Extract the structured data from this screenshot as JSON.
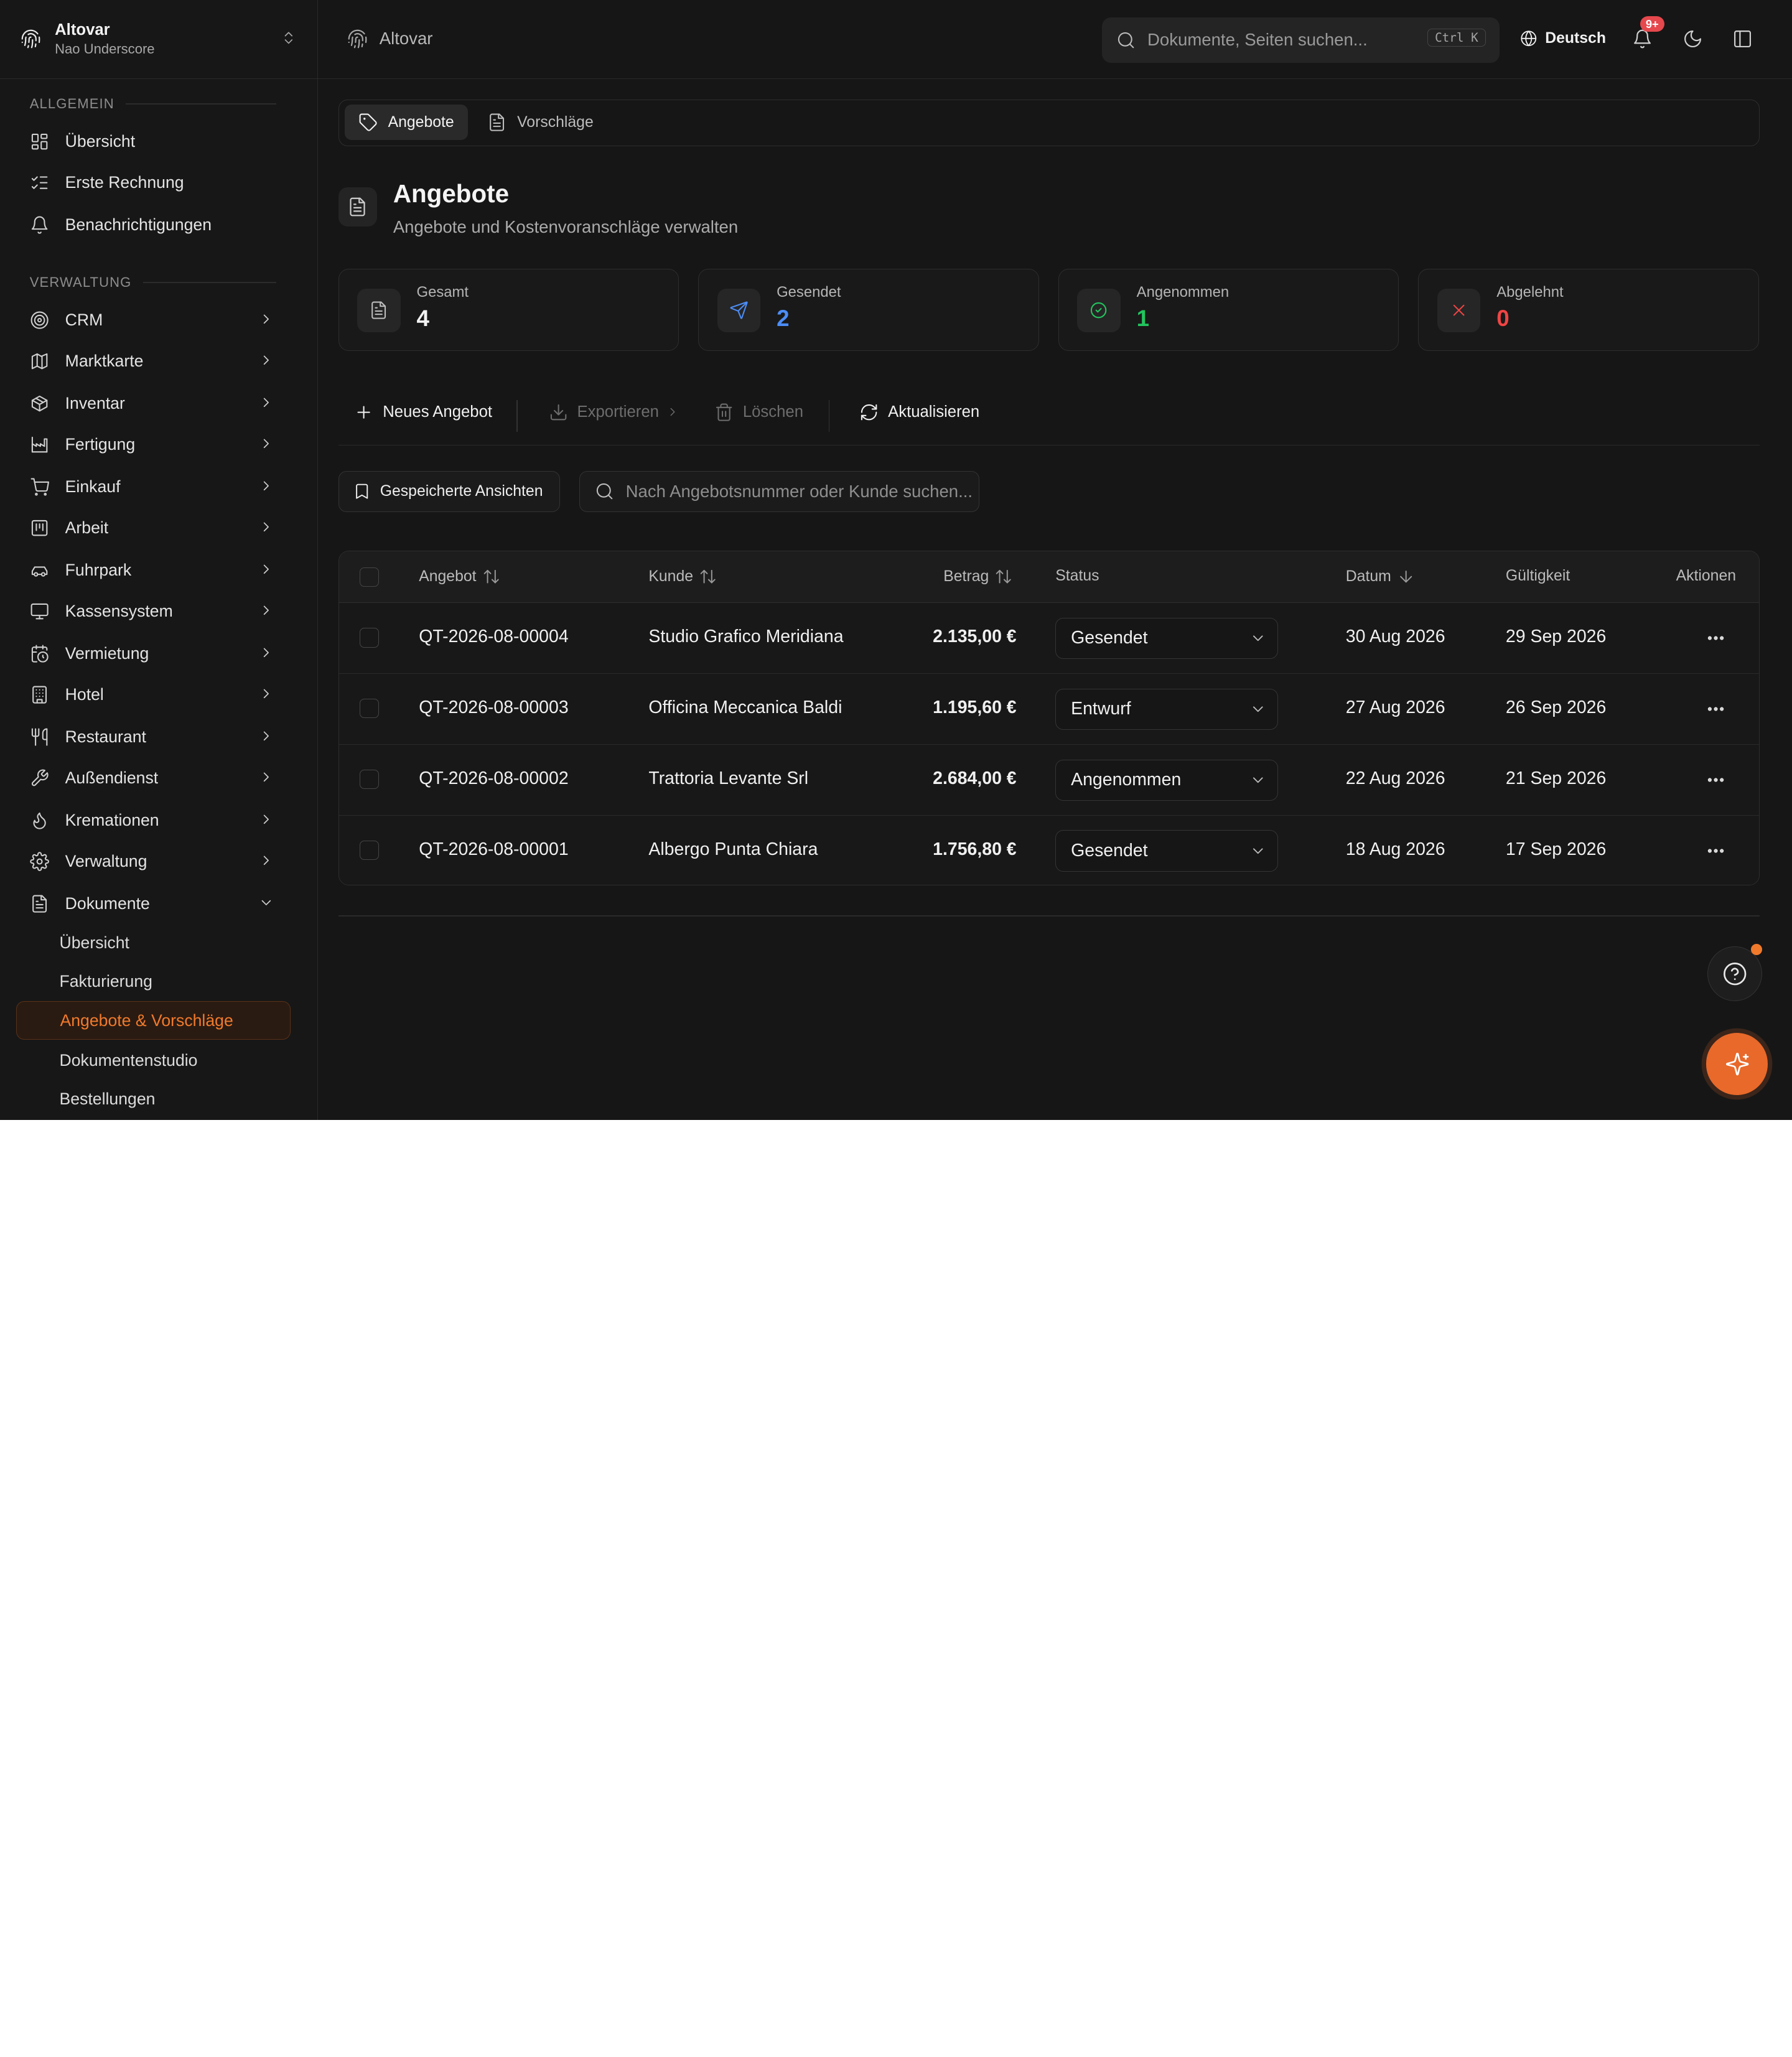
{
  "sidebar": {
    "org_name": "Altovar",
    "org_sub": "Nao Underscore",
    "section_general": "ALLGEMEIN",
    "section_admin": "VERWALTUNG",
    "general_items": [
      {
        "label": "Übersicht",
        "icon": "dashboard-icon"
      },
      {
        "label": "Erste Rechnung",
        "icon": "checklist-icon"
      },
      {
        "label": "Benachrichtigungen",
        "icon": "bell-icon"
      }
    ],
    "admin_items": [
      {
        "label": "CRM",
        "icon": "target-icon"
      },
      {
        "label": "Marktkarte",
        "icon": "map-icon"
      },
      {
        "label": "Inventar",
        "icon": "package-icon"
      },
      {
        "label": "Fertigung",
        "icon": "factory-icon"
      },
      {
        "label": "Einkauf",
        "icon": "cart-icon"
      },
      {
        "label": "Arbeit",
        "icon": "calendar-grid-icon"
      },
      {
        "label": "Fuhrpark",
        "icon": "car-icon"
      },
      {
        "label": "Kassensystem",
        "icon": "monitor-icon"
      },
      {
        "label": "Vermietung",
        "icon": "calendar-clock-icon"
      },
      {
        "label": "Hotel",
        "icon": "building-icon"
      },
      {
        "label": "Restaurant",
        "icon": "utensils-icon"
      },
      {
        "label": "Außendienst",
        "icon": "wrench-icon"
      },
      {
        "label": "Kremationen",
        "icon": "flame-icon"
      },
      {
        "label": "Verwaltung",
        "icon": "gear-icon"
      },
      {
        "label": "Dokumente",
        "icon": "document-icon"
      }
    ],
    "doc_subitems": [
      "Übersicht",
      "Fakturierung",
      "Angebote & Vorschläge",
      "Dokumentenstudio",
      "Bestellungen"
    ]
  },
  "topbar": {
    "breadcrumb": "Altovar",
    "search_placeholder": "Dokumente, Seiten suchen...",
    "search_shortcut": "Ctrl K",
    "language": "Deutsch",
    "notification_badge": "9+"
  },
  "tabs": [
    {
      "label": "Angebote",
      "active": true
    },
    {
      "label": "Vorschläge",
      "active": false
    }
  ],
  "page": {
    "title": "Angebote",
    "subtitle": "Angebote und Kostenvoranschläge verwalten"
  },
  "stats": [
    {
      "label": "Gesamt",
      "value": "4",
      "color": "#f2f2f2",
      "icon": "document-icon"
    },
    {
      "label": "Gesendet",
      "value": "2",
      "color": "#4c8df6",
      "icon": "send-icon"
    },
    {
      "label": "Angenommen",
      "value": "1",
      "color": "#22c55e",
      "icon": "check-circle-icon"
    },
    {
      "label": "Abgelehnt",
      "value": "0",
      "color": "#ef4444",
      "icon": "x-icon"
    }
  ],
  "toolbar": {
    "new": "Neues Angebot",
    "export": "Exportieren",
    "delete": "Löschen",
    "refresh": "Aktualisieren"
  },
  "filters": {
    "saved_views": "Gespeicherte Ansichten",
    "search_placeholder": "Nach Angebotsnummer oder Kunde suchen..."
  },
  "table": {
    "headers": [
      "Angebot",
      "Kunde",
      "Betrag",
      "Status",
      "Datum",
      "Gültigkeit",
      "Aktionen"
    ],
    "rows": [
      {
        "id": "QT-2026-08-00004",
        "customer": "Studio Grafico Meridiana",
        "amount": "2.135,00 €",
        "status": "Gesendet",
        "date": "30 Aug 2026",
        "valid": "29 Sep 2026"
      },
      {
        "id": "QT-2026-08-00003",
        "customer": "Officina Meccanica Baldi",
        "amount": "1.195,60 €",
        "status": "Entwurf",
        "date": "27 Aug 2026",
        "valid": "26 Sep 2026"
      },
      {
        "id": "QT-2026-08-00002",
        "customer": "Trattoria Levante Srl",
        "amount": "2.684,00 €",
        "status": "Angenommen",
        "date": "22 Aug 2026",
        "valid": "21 Sep 2026"
      },
      {
        "id": "QT-2026-08-00001",
        "customer": "Albergo Punta Chiara",
        "amount": "1.756,80 €",
        "status": "Gesendet",
        "date": "18 Aug 2026",
        "valid": "17 Sep 2026"
      }
    ]
  },
  "colors": {
    "accent": "#f07a2c",
    "background": "#161616"
  }
}
